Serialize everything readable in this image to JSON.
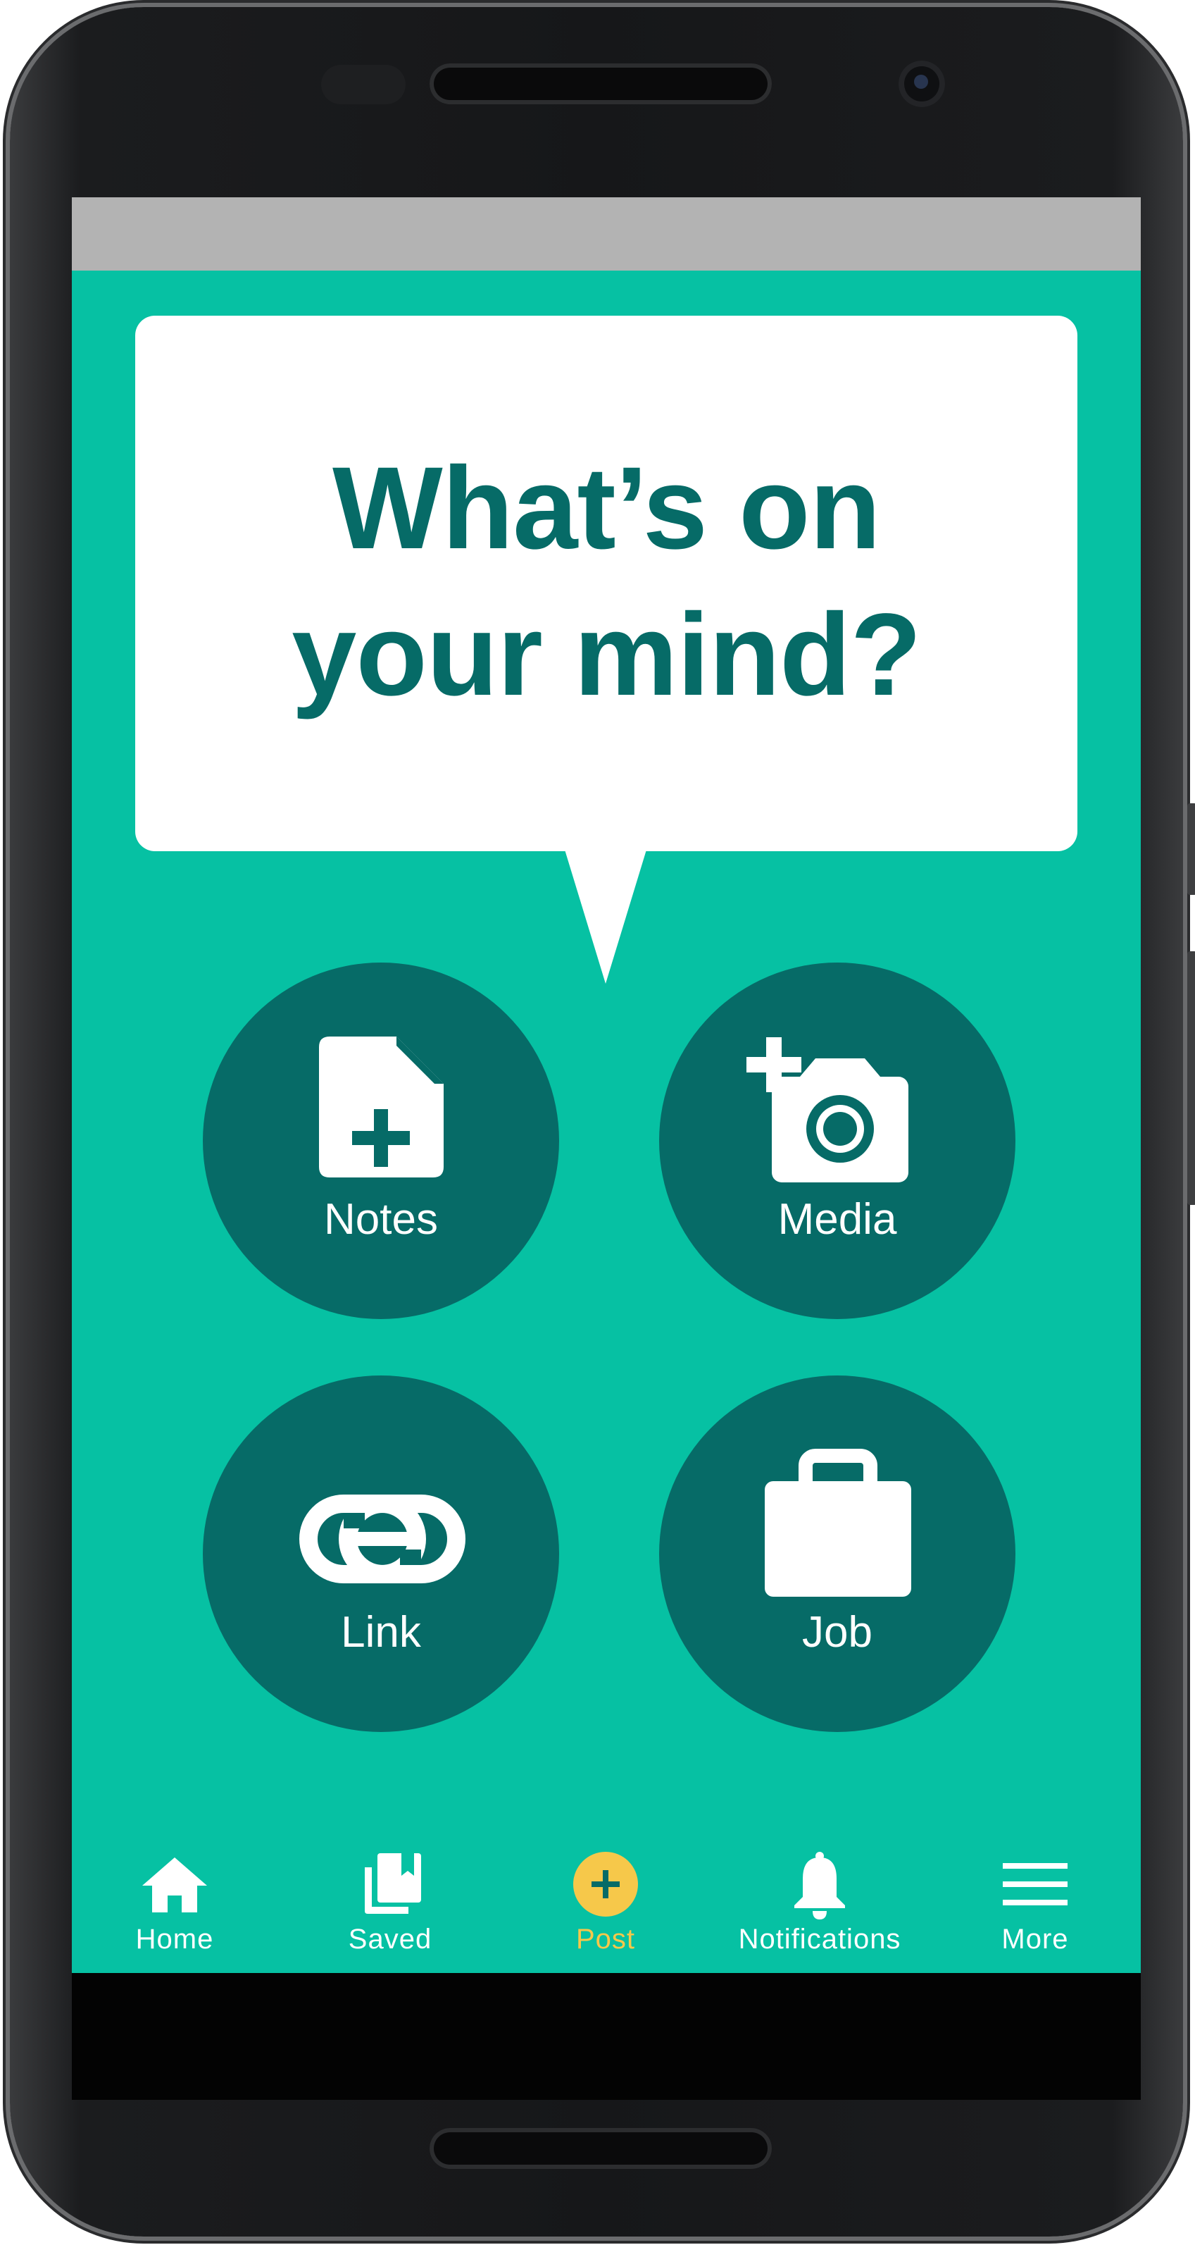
{
  "prompt": {
    "line1": "What’s on",
    "line2": "your mind?"
  },
  "actions": [
    {
      "id": "notes",
      "label": "Notes",
      "icon": "note-add-icon"
    },
    {
      "id": "media",
      "label": "Media",
      "icon": "add-photo-icon"
    },
    {
      "id": "link",
      "label": "Link",
      "icon": "link-icon"
    },
    {
      "id": "job",
      "label": "Job",
      "icon": "briefcase-icon"
    }
  ],
  "nav": {
    "home": {
      "label": "Home",
      "icon": "home-icon"
    },
    "saved": {
      "label": "Saved",
      "icon": "bookmarks-icon"
    },
    "post": {
      "label": "Post",
      "icon": "add-circle-icon"
    },
    "notifications": {
      "label": "Notifications",
      "icon": "bell-icon"
    },
    "more": {
      "label": "More",
      "icon": "menu-icon"
    }
  },
  "colors": {
    "background": "#06c1a3",
    "circle": "#066b67",
    "title": "#066b67",
    "status_bar": "#b3b3b3",
    "post_accent": "#f6c84a"
  }
}
